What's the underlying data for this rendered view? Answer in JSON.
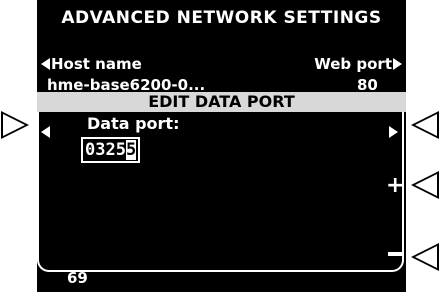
{
  "header": {
    "title": "ADVANCED NETWORK SETTINGS"
  },
  "nav": {
    "left_label": "Host name",
    "right_label": "Web port",
    "left_value": "hme-base6200-0...",
    "right_value": "80"
  },
  "dialog": {
    "title": "EDIT DATA PORT",
    "field_label": "Data port:",
    "value_prefix": "0325",
    "value_cursor_digit": "5",
    "plus_symbol": "+"
  },
  "footer": {
    "number": "69"
  },
  "colors": {
    "screen_bg": "#000000",
    "text": "#ffffff",
    "title_bar": "#d8d8d8"
  }
}
